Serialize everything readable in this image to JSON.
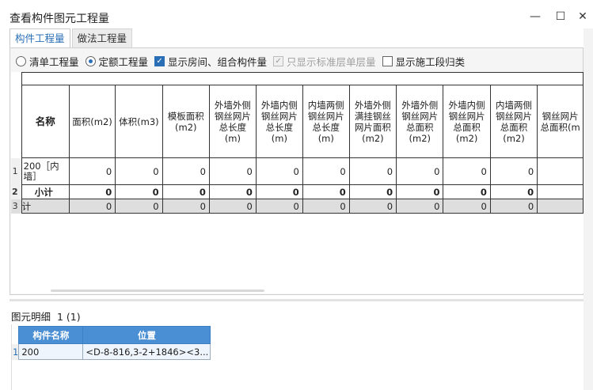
{
  "window": {
    "title": "查看构件图元工程量",
    "minimize": "—",
    "maximize": "☐",
    "close": "✕"
  },
  "tabs": [
    {
      "label": "构件工程量",
      "active": true
    },
    {
      "label": "做法工程量",
      "active": false
    }
  ],
  "options": {
    "radio_list": "清单工程量",
    "radio_quota": "定额工程量",
    "chk_rooms": "显示房间、组合构件量",
    "chk_standard": "只显示标准层单层量",
    "chk_segments": "显示施工段归类"
  },
  "grid": {
    "columns": [
      "名称",
      "面积(m2)",
      "体积(m3)",
      "模板面积(m2)",
      "外墙外侧钢丝网片总长度(m)",
      "外墙内侧钢丝网片总长度(m)",
      "内墙两侧钢丝网片总长度(m)",
      "外墙外侧满挂钢丝网片面积(m2)",
      "外墙外侧钢丝网片总面积(m2)",
      "外墙内侧钢丝网片总面积(m2)",
      "内墙两侧钢丝网片总面积(m2)",
      "钢丝网片总面积(m"
    ],
    "rows": [
      {
        "num": "1",
        "name": "200［内墙］",
        "values": [
          "0",
          "0",
          "0",
          "0",
          "0",
          "0",
          "0",
          "0",
          "0",
          "0",
          ""
        ]
      },
      {
        "num": "2",
        "name": "小计",
        "values": [
          "0",
          "0",
          "0",
          "0",
          "0",
          "0",
          "0",
          "0",
          "0",
          "0",
          ""
        ]
      },
      {
        "num": "3",
        "name": "计",
        "values": [
          "0",
          "0",
          "0",
          "0",
          "0",
          "0",
          "0",
          "0",
          "0",
          "0",
          ""
        ]
      }
    ]
  },
  "detail": {
    "label": "图元明细",
    "count": "1 (1)",
    "columns": [
      "构件名称",
      "位置"
    ],
    "rows": [
      {
        "num": "1",
        "name": "200",
        "position": "<D-8-816,3-2+1846><3..."
      }
    ]
  },
  "colors": {
    "accent": "#2a6fb5",
    "detail_header": "#4a8fd4",
    "total_row": "#dedede"
  }
}
